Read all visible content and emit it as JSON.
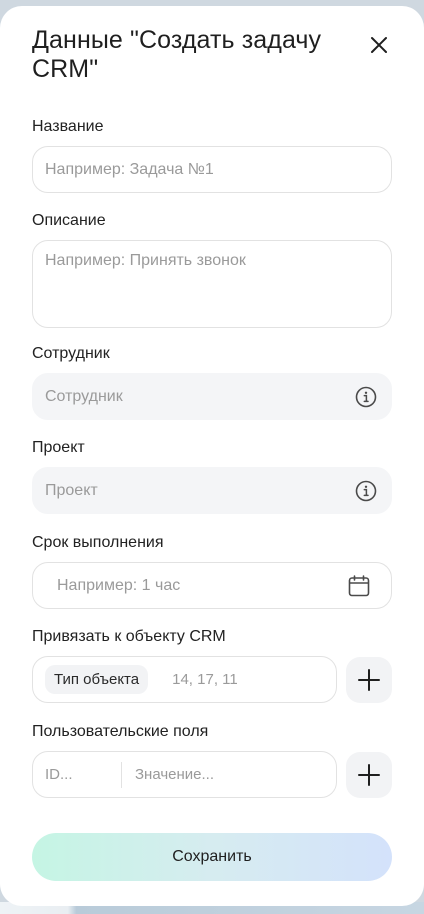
{
  "dialog": {
    "title": "Данные \"Создать задачу CRM\"",
    "close_icon": "close-icon"
  },
  "form": {
    "name": {
      "label": "Название",
      "placeholder": "Например: Задача №1",
      "value": ""
    },
    "description": {
      "label": "Описание",
      "placeholder": "Например: Принять звонок",
      "value": ""
    },
    "employee": {
      "label": "Сотрудник",
      "placeholder": "Сотрудник",
      "icon": "info-icon"
    },
    "project": {
      "label": "Проект",
      "placeholder": "Проект",
      "icon": "info-icon"
    },
    "deadline": {
      "label": "Срок выполнения",
      "placeholder": "Например: 1 час",
      "icon": "calendar-icon"
    },
    "crm_link": {
      "label": "Привязать к объекту CRM",
      "chip": "Тип объекта",
      "ids_placeholder": "14, 17, 11",
      "add_icon": "plus-icon"
    },
    "custom_fields": {
      "label": "Пользовательские поля",
      "id_placeholder": "ID...",
      "value_placeholder": "Значение...",
      "add_icon": "plus-icon"
    }
  },
  "actions": {
    "save_label": "Сохранить"
  },
  "colors": {
    "save_gradient_start": "#c5f5e4",
    "save_gradient_end": "#d4e2fb",
    "filled_field_bg": "#f4f5f7",
    "border": "#e2e2e2"
  }
}
